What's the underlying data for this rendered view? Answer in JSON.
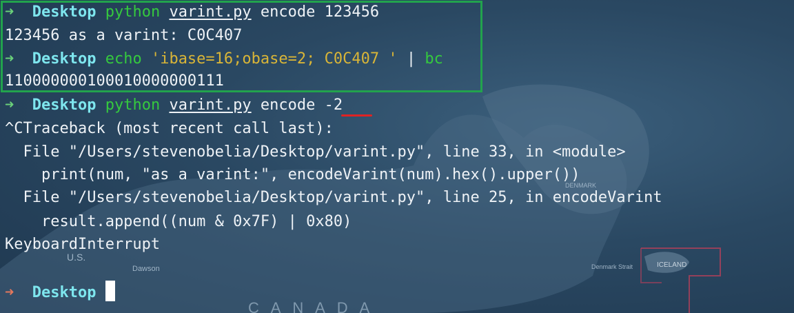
{
  "prompt": {
    "arrow": "➜",
    "dir": "Desktop"
  },
  "lines": {
    "l1": {
      "cmd": "python",
      "file": "varint.py",
      "args": "encode 123456"
    },
    "l2": {
      "text": "123456 as a varint: C0C407"
    },
    "l3": {
      "cmd": "echo",
      "str": "'ibase=16;obase=2; C0C407 '",
      "pipe": "|",
      "cmd2": "bc"
    },
    "l4": {
      "text": "110000000100010000000111"
    },
    "l5": {
      "cmd": "python",
      "file": "varint.py",
      "args": "encode",
      "neg": "-2"
    },
    "l6": {
      "text": "^CTraceback (most recent call last):"
    },
    "l7": {
      "text": "  File \"/Users/stevenobelia/Desktop/varint.py\", line 33, in <module>"
    },
    "l8": {
      "text": "    print(num, \"as a varint:\", encodeVarint(num).hex().upper())"
    },
    "l9": {
      "text": "  File \"/Users/stevenobelia/Desktop/varint.py\", line 25, in encodeVarint"
    },
    "l10": {
      "text": "    result.append((num & 0x7F) | 0x80)"
    },
    "l11": {
      "text": "KeyboardInterrupt"
    }
  },
  "map_labels": {
    "us": "U.S.",
    "dawson": "Dawson",
    "iceland": "ICELAND",
    "dm": "DENMARK",
    "denmark_strait": "Denmark Strait",
    "canada": "C A N A D A"
  },
  "colors": {
    "highlight_box": "#22a34d",
    "highlight_underline": "#e02323",
    "prompt_arrow_ok": "#6ad07a",
    "prompt_arrow_fail": "#e5785c",
    "dir": "#7ee6ee",
    "command": "#35c93e",
    "string": "#d9b537",
    "text": "#eef2f6"
  }
}
